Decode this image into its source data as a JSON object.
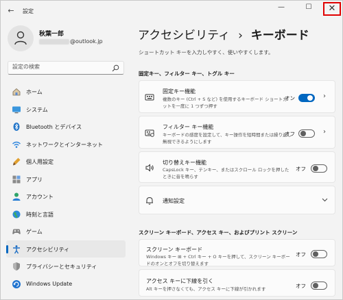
{
  "window": {
    "title": "設定",
    "back_icon": "←",
    "min_icon": "—",
    "max_icon": "☐",
    "close_icon": "✕"
  },
  "profile": {
    "name": "秋葉一郎",
    "email_visible": "@outlook.jp"
  },
  "search": {
    "placeholder": "設定の検索"
  },
  "nav": {
    "items": [
      {
        "label": "ホーム",
        "icon": "home-icon"
      },
      {
        "label": "システム",
        "icon": "system-icon"
      },
      {
        "label": "Bluetooth とデバイス",
        "icon": "bluetooth-icon"
      },
      {
        "label": "ネットワークとインターネット",
        "icon": "wifi-icon"
      },
      {
        "label": "個人用設定",
        "icon": "brush-icon"
      },
      {
        "label": "アプリ",
        "icon": "apps-icon"
      },
      {
        "label": "アカウント",
        "icon": "account-icon"
      },
      {
        "label": "時刻と言語",
        "icon": "globe-icon"
      },
      {
        "label": "ゲーム",
        "icon": "game-icon"
      },
      {
        "label": "アクセシビリティ",
        "icon": "accessibility-icon",
        "selected": true
      },
      {
        "label": "プライバシーとセキュリティ",
        "icon": "shield-icon"
      },
      {
        "label": "Windows Update",
        "icon": "update-icon"
      }
    ]
  },
  "main": {
    "breadcrumb_parent": "アクセシビリティ",
    "breadcrumb_sep": "›",
    "breadcrumb_current": "キーボード",
    "description": "ショートカット キーを入力しやすく、使いやすくします。",
    "section1": "固定キー、フィルター キー、トグル キー",
    "sticky": {
      "title": "固定キー機能",
      "desc": "複数のキー (Ctrl + S など) を使用するキーボード ショートカットを一度に 1 つずつ押す",
      "state": "オン"
    },
    "filter": {
      "title": "フィルター キー機能",
      "desc": "キーボードの感度を設定して、キー操作を短時間または繰り返し無視できるようにします",
      "state": "オフ"
    },
    "toggle": {
      "title": "切り替えキー機能",
      "desc": "CapsLock キー、テンキー、またはスクロール ロックを押したときに音を鳴らす",
      "state": "オフ"
    },
    "notify": {
      "title": "通知設定"
    },
    "section2": "スクリーン キーボード、アクセス キー、およびプリント スクリーン",
    "osk": {
      "title": "スクリーン キーボード",
      "desc": "Windows キー ⊞ + Ctrl キー + O キーを押して、スクリーン キーボードのオンとオフを切り替えます",
      "state": "オフ"
    },
    "access": {
      "title": "アクセス キーに下線を引く",
      "desc": "Alt キーを押さなくても、アクセス キーに下線が引かれます",
      "state": "オフ"
    }
  }
}
